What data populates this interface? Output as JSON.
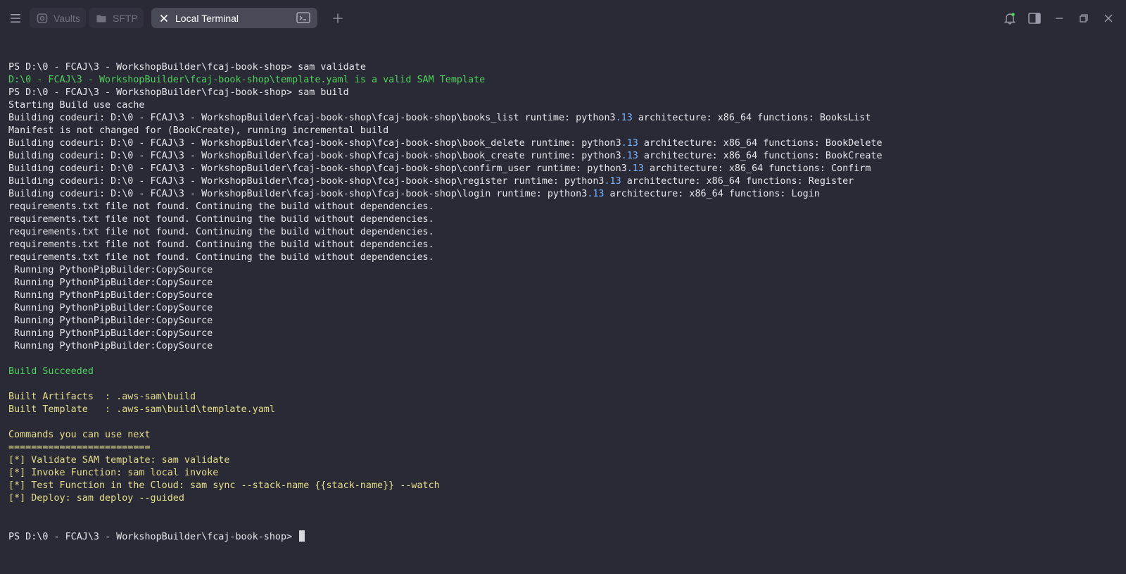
{
  "tabs": [
    {
      "label": "Vaults",
      "icon": "vault-icon",
      "active": false
    },
    {
      "label": "SFTP",
      "icon": "folder-icon",
      "active": false
    },
    {
      "label": "Local Terminal",
      "icon": "terminal-icon",
      "active": true
    }
  ],
  "colors": {
    "background": "#292a36",
    "prompt": "#e6e6ea",
    "success_green": "#4ed25b",
    "info_yellow": "#e6df8a",
    "number_blue": "#7bb4ff",
    "active_tab": "#484a57",
    "inactive_tab": "#31323f"
  },
  "terminal": {
    "lines": [
      {
        "text": "PS D:\\0 - FCAJ\\3 - WorkshopBuilder\\fcaj-book-shop> sam validate",
        "style": "white"
      },
      {
        "text": "D:\\0 - FCAJ\\3 - WorkshopBuilder\\fcaj-book-shop\\template.yaml is a valid SAM Template",
        "style": "green"
      },
      {
        "text": "PS D:\\0 - FCAJ\\3 - WorkshopBuilder\\fcaj-book-shop> sam build",
        "style": "white"
      },
      {
        "text": "Starting Build use cache",
        "style": "white"
      },
      {
        "text": "Building codeuri: D:\\0 - FCAJ\\3 - WorkshopBuilder\\fcaj-book-shop\\fcaj-book-shop\\books_list runtime: python3.13 architecture: x86_64 functions: BooksList",
        "style": "white"
      },
      {
        "text": "Manifest is not changed for (BookCreate), running incremental build",
        "style": "white"
      },
      {
        "text": "Building codeuri: D:\\0 - FCAJ\\3 - WorkshopBuilder\\fcaj-book-shop\\fcaj-book-shop\\book_delete runtime: python3.13 architecture: x86_64 functions: BookDelete",
        "style": "white"
      },
      {
        "text": "Building codeuri: D:\\0 - FCAJ\\3 - WorkshopBuilder\\fcaj-book-shop\\fcaj-book-shop\\book_create runtime: python3.13 architecture: x86_64 functions: BookCreate",
        "style": "white"
      },
      {
        "text": "Building codeuri: D:\\0 - FCAJ\\3 - WorkshopBuilder\\fcaj-book-shop\\fcaj-book-shop\\confirm_user runtime: python3.13 architecture: x86_64 functions: Confirm",
        "style": "white"
      },
      {
        "text": "Building codeuri: D:\\0 - FCAJ\\3 - WorkshopBuilder\\fcaj-book-shop\\fcaj-book-shop\\register runtime: python3.13 architecture: x86_64 functions: Register",
        "style": "white"
      },
      {
        "text": "Building codeuri: D:\\0 - FCAJ\\3 - WorkshopBuilder\\fcaj-book-shop\\fcaj-book-shop\\login runtime: python3.13 architecture: x86_64 functions: Login",
        "style": "white"
      },
      {
        "text": "requirements.txt file not found. Continuing the build without dependencies.",
        "style": "white"
      },
      {
        "text": "requirements.txt file not found. Continuing the build without dependencies.",
        "style": "white"
      },
      {
        "text": "requirements.txt file not found. Continuing the build without dependencies.",
        "style": "white"
      },
      {
        "text": "requirements.txt file not found. Continuing the build without dependencies.",
        "style": "white"
      },
      {
        "text": "requirements.txt file not found. Continuing the build without dependencies.",
        "style": "white"
      },
      {
        "text": " Running PythonPipBuilder:CopySource",
        "style": "white"
      },
      {
        "text": " Running PythonPipBuilder:CopySource",
        "style": "white"
      },
      {
        "text": " Running PythonPipBuilder:CopySource",
        "style": "white"
      },
      {
        "text": " Running PythonPipBuilder:CopySource",
        "style": "white"
      },
      {
        "text": " Running PythonPipBuilder:CopySource",
        "style": "white"
      },
      {
        "text": " Running PythonPipBuilder:CopySource",
        "style": "white"
      },
      {
        "text": " Running PythonPipBuilder:CopySource",
        "style": "white"
      },
      {
        "text": "",
        "style": "white"
      },
      {
        "text": "Build Succeeded",
        "style": "green"
      },
      {
        "text": "",
        "style": "white"
      },
      {
        "text": "Built Artifacts  : .aws-sam\\build",
        "style": "yellow"
      },
      {
        "text": "Built Template   : .aws-sam\\build\\template.yaml",
        "style": "yellow"
      },
      {
        "text": "",
        "style": "white"
      },
      {
        "text": "Commands you can use next",
        "style": "yellow"
      },
      {
        "text": "=========================",
        "style": "yellow"
      },
      {
        "text": "[*] Validate SAM template: sam validate",
        "style": "yellow"
      },
      {
        "text": "[*] Invoke Function: sam local invoke",
        "style": "yellow"
      },
      {
        "text": "[*] Test Function in the Cloud: sam sync --stack-name {{stack-name}} --watch",
        "style": "yellow"
      },
      {
        "text": "[*] Deploy: sam deploy --guided",
        "style": "yellow"
      }
    ],
    "prompt": "PS D:\\0 - FCAJ\\3 - WorkshopBuilder\\fcaj-book-shop> "
  },
  "icons": {
    "menu": "hamburger-menu-icon",
    "new_tab": "plus-icon",
    "notifications": "bell-icon",
    "sidebar": "sidebar-toggle-icon",
    "minimize": "minimize-icon",
    "restore": "restore-icon",
    "close": "close-icon"
  }
}
